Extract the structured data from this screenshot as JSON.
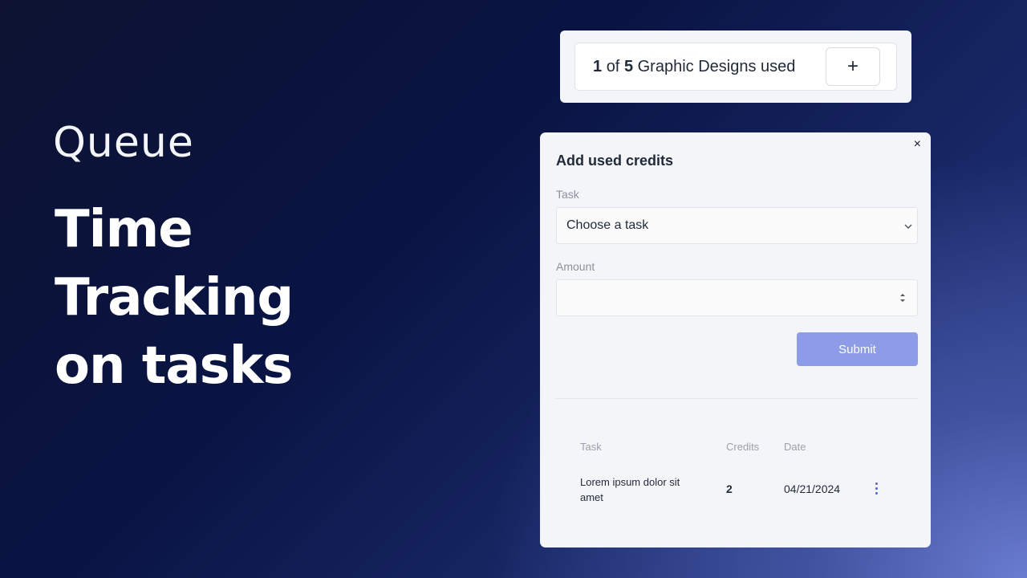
{
  "brand": {
    "logo": "Queue",
    "headline": [
      "Time",
      "Tracking",
      "on tasks"
    ]
  },
  "counter": {
    "used": "1",
    "of": "of",
    "total": "5",
    "label": "Graphic Designs used",
    "add_label": "+"
  },
  "modal": {
    "title": "Add used credits",
    "close_label": "×",
    "task_label": "Task",
    "task_placeholder": "Choose a task",
    "amount_label": "Amount",
    "submit_label": "Submit"
  },
  "table": {
    "headers": {
      "task": "Task",
      "credits": "Credits",
      "date": "Date"
    },
    "rows": [
      {
        "task": "Lorem ipsum dolor sit amet",
        "credits": "2",
        "date": "04/21/2024"
      }
    ]
  },
  "colors": {
    "accent": "#4f63d6",
    "submit_bg": "#8c9ce6"
  }
}
